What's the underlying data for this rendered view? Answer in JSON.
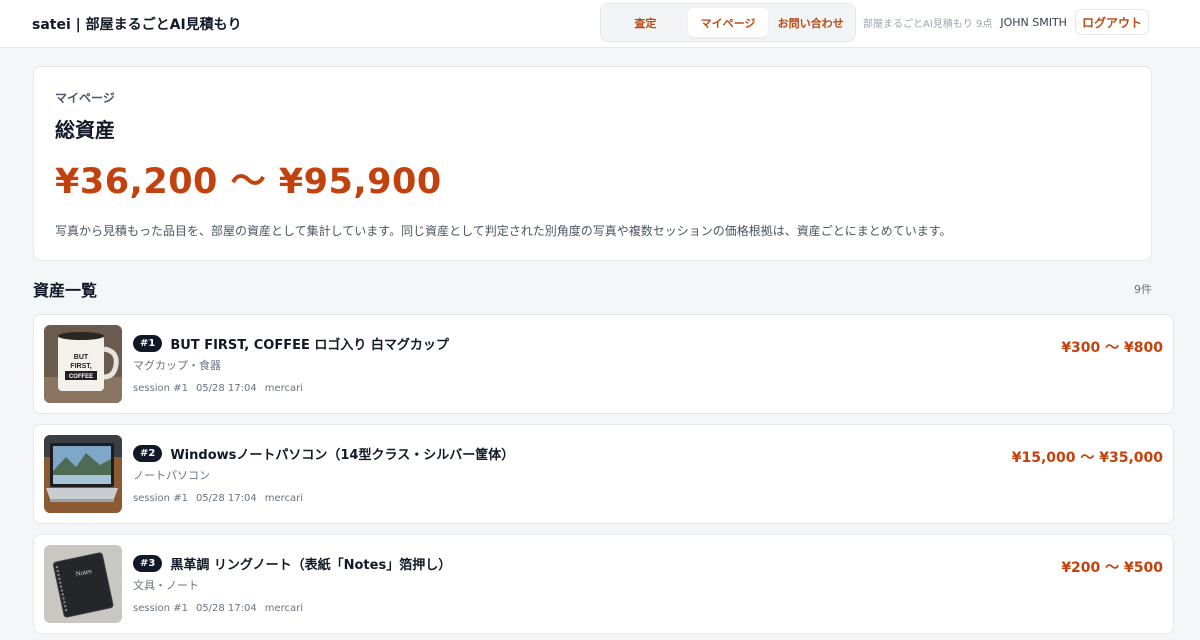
{
  "header": {
    "brand": "satei | 部屋まるごとAI見積もり",
    "tabs": [
      {
        "label": "査定",
        "active": false
      },
      {
        "label": "マイページ",
        "active": true
      },
      {
        "label": "お問い合わせ",
        "active": false
      }
    ],
    "app_meta": "部屋まるごとAI見積もり 9点",
    "user_name": "JOHN SMITH",
    "logout_label": "ログアウト"
  },
  "summary": {
    "crumb": "マイページ",
    "title": "総資産",
    "total": "¥36,200 〜 ¥95,900",
    "description": "写真から見積もった品目を、部屋の資産として集計しています。同じ資産として判定された別角度の写真や複数セッションの価格根拠は、資産ごとにまとめています。"
  },
  "list": {
    "title": "資産一覧",
    "count": "9件",
    "items": [
      {
        "rank": "#1",
        "title": "BUT FIRST, COFFEE ロゴ入り 白マグカップ",
        "category": "マグカップ・食器",
        "session": "session #1",
        "date": "05/28 17:04",
        "source": "mercari",
        "price": "¥300 〜 ¥800",
        "thumb_icon": "mug-photo"
      },
      {
        "rank": "#2",
        "title": "Windowsノートパソコン（14型クラス・シルバー筐体）",
        "category": "ノートパソコン",
        "session": "session #1",
        "date": "05/28 17:04",
        "source": "mercari",
        "price": "¥15,000 〜 ¥35,000",
        "thumb_icon": "laptop-photo"
      },
      {
        "rank": "#3",
        "title": "黒革調 リングノート（表紙「Notes」箔押し）",
        "category": "文具・ノート",
        "session": "session #1",
        "date": "05/28 17:04",
        "source": "mercari",
        "price": "¥200 〜 ¥500",
        "thumb_icon": "notebook-photo"
      }
    ]
  },
  "thumb_mug": {
    "line1": "BUT",
    "line2": "FIRST,",
    "line3": "COFFEE"
  },
  "thumb_notebook": {
    "text": "Notes"
  },
  "colors": {
    "accent": "#c2410c",
    "badge": "#111827"
  }
}
